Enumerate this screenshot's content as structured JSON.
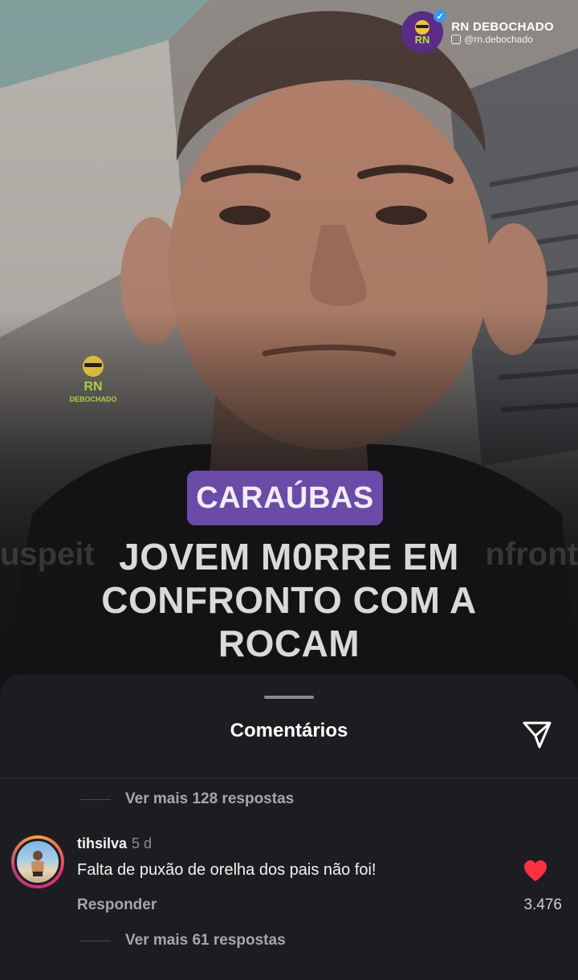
{
  "post": {
    "brand_name": "RN DEBOCHADO",
    "brand_handle": "@rn.debochado",
    "logo_text": "RN",
    "watermark_text": "RN",
    "watermark_sub": "DEBOCHADO",
    "tag": "CARAÚBAS",
    "headline_lines": [
      "JOVEM M0RRE EM",
      "CONFRONTO COM A",
      "ROCAM"
    ],
    "ghost_left": "uspeit",
    "ghost_right": "nfront"
  },
  "sheet": {
    "title": "Comentários",
    "more_replies_top": "Ver mais 128 respostas",
    "more_replies_bottom": "Ver mais 61 respostas"
  },
  "comment": {
    "username": "tihsilva",
    "time": "5 d",
    "text": "Falta de puxão de orelha dos pais não foi!",
    "reply_label": "Responder",
    "likes": "3.476"
  },
  "icons": {
    "share": "send-icon",
    "like": "heart-icon",
    "verified": "verified-badge-icon"
  },
  "colors": {
    "tag_bg": "#6b4ba8",
    "sheet_bg": "#1c1d20",
    "heart": "#ff3040",
    "brand_logo": "#5a2b88"
  }
}
